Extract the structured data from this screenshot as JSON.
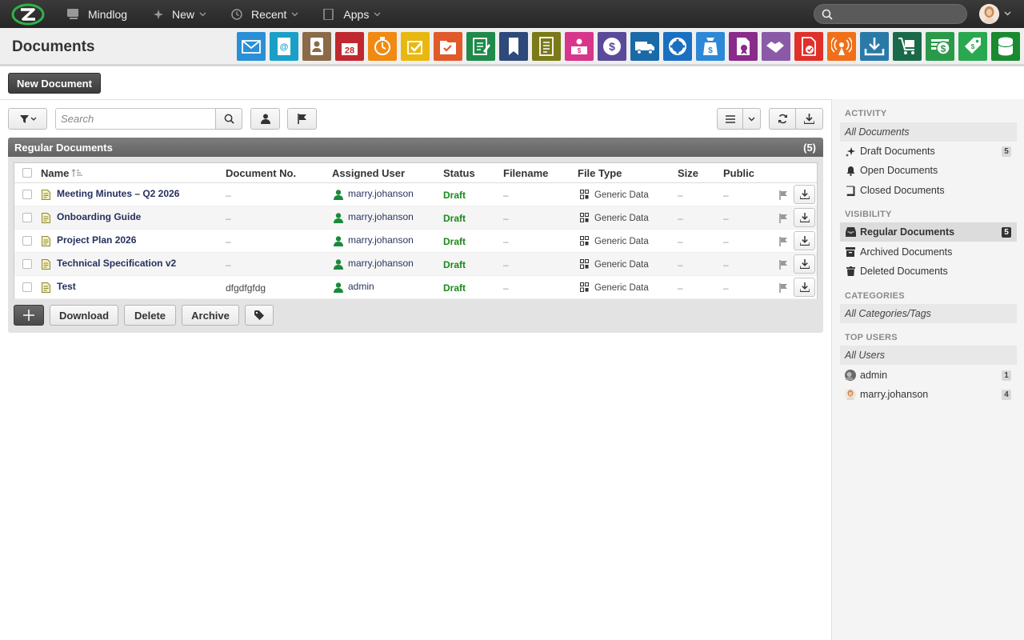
{
  "topbar": {
    "brand": "Mindlog",
    "new_label": "New",
    "recent_label": "Recent",
    "apps_label": "Apps",
    "search_placeholder": ""
  },
  "header": {
    "title": "Documents",
    "calendar_day": "28"
  },
  "apps": [
    {
      "name": "email",
      "color": "#2b8fd6"
    },
    {
      "name": "address-book",
      "color": "#1aa0c8"
    },
    {
      "name": "contacts",
      "color": "#8a6a48"
    },
    {
      "name": "calendar",
      "color": "#c0282f"
    },
    {
      "name": "timer",
      "color": "#f08a12"
    },
    {
      "name": "tasks",
      "color": "#e8b810"
    },
    {
      "name": "projects",
      "color": "#e05a2a"
    },
    {
      "name": "notes",
      "color": "#1f8a4a"
    },
    {
      "name": "bookmarks",
      "color": "#2e4a7a"
    },
    {
      "name": "documents",
      "color": "#7a7a18"
    },
    {
      "name": "reception",
      "color": "#d8368a"
    },
    {
      "name": "billing",
      "color": "#5a4a9a"
    },
    {
      "name": "delivery",
      "color": "#1a6aa8"
    },
    {
      "name": "support",
      "color": "#1a70c0"
    },
    {
      "name": "expenses",
      "color": "#2d88d8"
    },
    {
      "name": "contracts",
      "color": "#8a2a8a"
    },
    {
      "name": "deals",
      "color": "#8a5aa8"
    },
    {
      "name": "invoices",
      "color": "#e0302a"
    },
    {
      "name": "broadcast",
      "color": "#f0701a"
    },
    {
      "name": "downloads",
      "color": "#2a7aa8"
    },
    {
      "name": "inventory",
      "color": "#1a6a4a"
    },
    {
      "name": "accounting",
      "color": "#2a9a4a"
    },
    {
      "name": "tags",
      "color": "#2aa850"
    },
    {
      "name": "database",
      "color": "#1a8a30"
    }
  ],
  "toolbar": {
    "new_document_label": "New Document",
    "search_placeholder": "Search"
  },
  "panel": {
    "title": "Regular Documents",
    "count": "(5)",
    "columns": {
      "name": "Name",
      "doc_no": "Document No.",
      "assigned": "Assigned User",
      "status": "Status",
      "filename": "Filename",
      "filetype": "File Type",
      "size": "Size",
      "public": "Public"
    },
    "rows": [
      {
        "name": "Meeting Minutes – Q2 2026",
        "doc_no": "–",
        "user": "marry.johanson",
        "status": "Draft",
        "filename": "–",
        "filetype": "Generic Data",
        "size": "–",
        "public": "–"
      },
      {
        "name": "Onboarding Guide",
        "doc_no": "–",
        "user": "marry.johanson",
        "status": "Draft",
        "filename": "–",
        "filetype": "Generic Data",
        "size": "–",
        "public": "–"
      },
      {
        "name": "Project Plan 2026",
        "doc_no": "–",
        "user": "marry.johanson",
        "status": "Draft",
        "filename": "–",
        "filetype": "Generic Data",
        "size": "–",
        "public": "–"
      },
      {
        "name": "Technical Specification v2",
        "doc_no": "–",
        "user": "marry.johanson",
        "status": "Draft",
        "filename": "–",
        "filetype": "Generic Data",
        "size": "–",
        "public": "–"
      },
      {
        "name": "Test",
        "doc_no": "dfgdfgfdg",
        "user": "admin",
        "status": "Draft",
        "filename": "–",
        "filetype": "Generic Data",
        "size": "–",
        "public": "–"
      }
    ],
    "actions": {
      "add": "+",
      "download": "Download",
      "delete": "Delete",
      "archive": "Archive"
    }
  },
  "sidebar": {
    "activity_heading": "ACTIVITY",
    "all_documents": "All Documents",
    "draft_documents": "Draft Documents",
    "draft_count": "5",
    "open_documents": "Open Documents",
    "closed_documents": "Closed Documents",
    "visibility_heading": "VISIBILITY",
    "regular_documents": "Regular Documents",
    "regular_count": "5",
    "archived_documents": "Archived Documents",
    "deleted_documents": "Deleted Documents",
    "categories_heading": "CATEGORIES",
    "all_categories": "All Categories/Tags",
    "top_users_heading": "TOP USERS",
    "all_users": "All Users",
    "users": [
      {
        "name": "admin",
        "count": "1"
      },
      {
        "name": "marry.johanson",
        "count": "4"
      }
    ]
  }
}
